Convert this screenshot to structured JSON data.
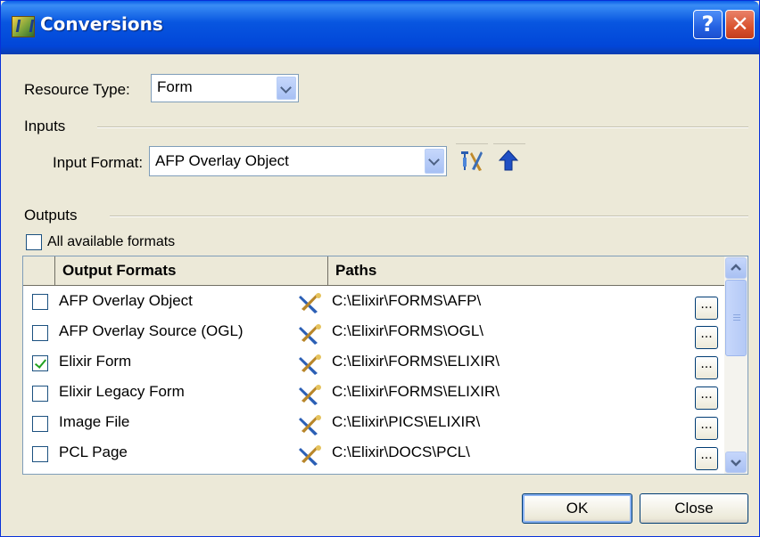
{
  "window": {
    "title": "Conversions"
  },
  "titlebar": {
    "help_label": "?",
    "close_label": "✕"
  },
  "resource_type": {
    "label": "Resource Type:",
    "value": "Form"
  },
  "inputs": {
    "group_label": "Inputs",
    "input_format_label": "Input Format:",
    "input_format_value": "AFP Overlay Object"
  },
  "outputs": {
    "group_label": "Outputs",
    "all_formats_label": "All available formats",
    "all_formats_checked": false,
    "columns": {
      "formats": "Output Formats",
      "paths": "Paths"
    },
    "browse_label": "...",
    "rows": [
      {
        "format": "AFP Overlay Object",
        "path": "C:\\Elixir\\FORMS\\AFP\\",
        "checked": false
      },
      {
        "format": "AFP Overlay Source (OGL)",
        "path": "C:\\Elixir\\FORMS\\OGL\\",
        "checked": false
      },
      {
        "format": "Elixir Form",
        "path": "C:\\Elixir\\FORMS\\ELIXIR\\",
        "checked": true
      },
      {
        "format": "Elixir Legacy Form",
        "path": "C:\\Elixir\\FORMS\\ELIXIR\\",
        "checked": false
      },
      {
        "format": "Image File",
        "path": "C:\\Elixir\\PICS\\ELIXIR\\",
        "checked": false
      },
      {
        "format": "PCL Page",
        "path": "C:\\Elixir\\DOCS\\PCL\\",
        "checked": false
      }
    ]
  },
  "buttons": {
    "ok": "OK",
    "close": "Close"
  },
  "colors": {
    "titlebar": "#0146d8",
    "face": "#ece9d8",
    "border": "#7f9db9",
    "check": "#21a121"
  },
  "icons": [
    "app-icon",
    "help-icon",
    "close-icon",
    "settings-tools-icon",
    "up-arrow-icon",
    "tools-icon",
    "scroll-up-icon",
    "scroll-down-icon"
  ]
}
